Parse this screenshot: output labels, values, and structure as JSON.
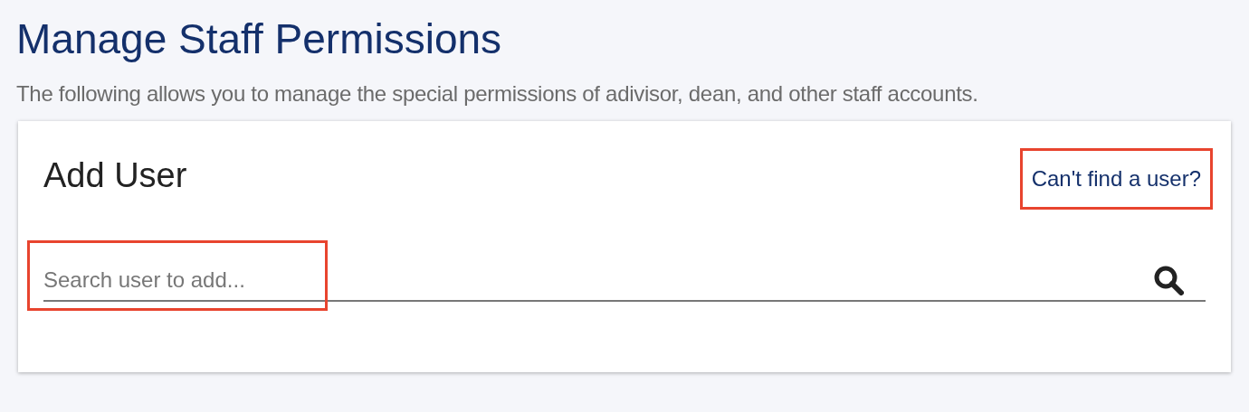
{
  "page": {
    "title": "Manage Staff Permissions",
    "description": "The following allows you to manage the special permissions of adivisor, dean, and other staff accounts."
  },
  "card": {
    "title": "Add User",
    "help_link": {
      "label": "Can't find a user?",
      "highlighted": true
    },
    "search": {
      "placeholder": "Search user to add...",
      "highlighted": true
    }
  }
}
